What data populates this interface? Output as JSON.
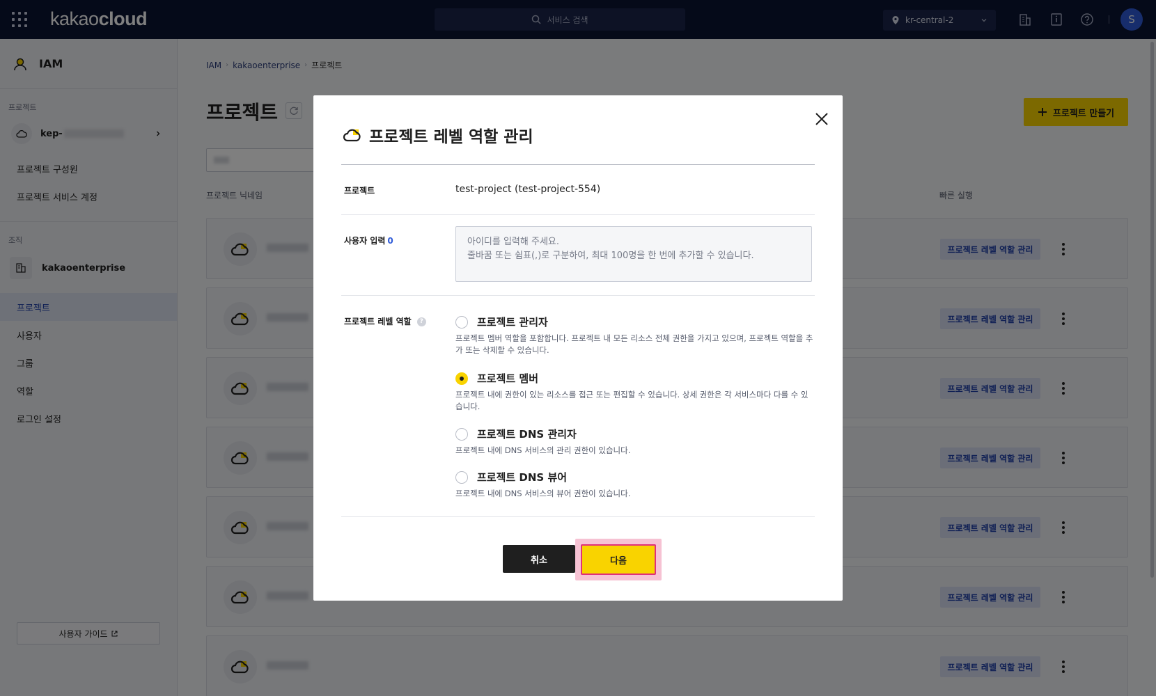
{
  "topbar": {
    "logo_light": "kakao",
    "logo_bold": "cloud",
    "search_placeholder": "서비스 검색",
    "region": "kr-central-2",
    "avatar_initial": "S"
  },
  "sidebar": {
    "title": "IAM",
    "project_section": "프로젝트",
    "project_name_prefix": "kep-",
    "project_items": [
      "프로젝트 구성원",
      "프로젝트 서비스 계정"
    ],
    "org_section": "조직",
    "org_name": "kakaoenterprise",
    "org_items": [
      "프로젝트",
      "사용자",
      "그룹",
      "역할",
      "로그인 설정"
    ],
    "active_item": "프로젝트",
    "guide_button": "사용자 가이드"
  },
  "main": {
    "breadcrumb": [
      "IAM",
      "kakaoenterprise",
      "프로젝트"
    ],
    "title": "프로젝트",
    "create_button": "프로젝트 만들기",
    "col_nickname": "프로젝트 닉네임",
    "col_quick": "빠른 실행",
    "row_action": "프로젝트 레벨 역할 관리",
    "row_count": 7
  },
  "modal": {
    "title": "프로젝트 레벨 역할 관리",
    "project_label": "프로젝트",
    "project_value": "test-project (test-project-554)",
    "user_input_label": "사용자 입력",
    "user_input_count": "0",
    "user_input_placeholder_line1": "아이디를 입력해 주세요.",
    "user_input_placeholder_line2": "줄바꿈 또는 쉼표(,)로 구분하여, 최대 100명을 한 번에 추가할 수 있습니다.",
    "role_label": "프로젝트 레벨 역할",
    "options": [
      {
        "title": "프로젝트 관리자",
        "desc": "프로젝트 멤버 역할을 포함합니다. 프로젝트 내 모든 리소스 전체 권한을 가지고 있으며, 프로젝트 역할을 추가 또는 삭제할 수 있습니다.",
        "selected": false
      },
      {
        "title": "프로젝트 멤버",
        "desc": "프로젝트 내에 권한이 있는 리소스를 접근 또는 편집할 수 있습니다. 상세 권한은 각 서비스마다 다를 수 있습니다.",
        "selected": true
      },
      {
        "title": "프로젝트 DNS 관리자",
        "desc": "프로젝트 내에 DNS 서비스의 관리 권한이 있습니다.",
        "selected": false
      },
      {
        "title": "프로젝트 DNS 뷰어",
        "desc": "프로젝트 내에 DNS 서비스의 뷰어 권한이 있습니다.",
        "selected": false
      }
    ],
    "cancel_button": "취소",
    "next_button": "다음"
  },
  "colors": {
    "accent_yellow": "#f9d300",
    "topbar_navy": "#0b1433",
    "link_blue": "#1e3fa8",
    "highlight_pink": "#e0307a"
  },
  "icons": [
    "apps-grid-icon",
    "search-icon",
    "location-pin-icon",
    "chevron-down-icon",
    "building-icon",
    "info-book-icon",
    "help-icon",
    "user-icon",
    "cloud-icon",
    "chevron-right-icon",
    "external-link-icon",
    "refresh-icon",
    "plus-icon",
    "kebab-icon",
    "close-icon",
    "project-cloud-icon"
  ]
}
